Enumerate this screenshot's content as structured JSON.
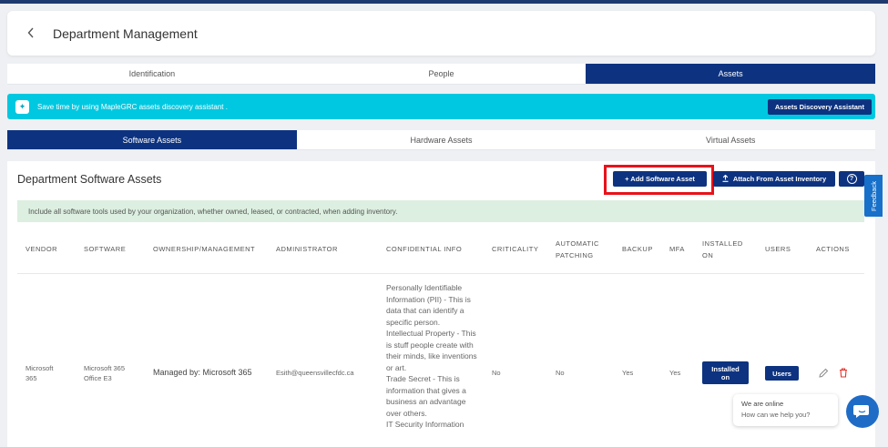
{
  "header": {
    "back_icon": "chevron-left-icon",
    "title": "Department Management"
  },
  "tabs": [
    {
      "label": "Identification",
      "active": false
    },
    {
      "label": "People",
      "active": false
    },
    {
      "label": "Assets",
      "active": true
    }
  ],
  "banner": {
    "icon": "sparkle-icon",
    "text": "Save time by using MapleGRC assets discovery assistant .",
    "button_label": "Assets Discovery Assistant"
  },
  "asset_tabs": [
    {
      "label": "Software Assets",
      "active": true
    },
    {
      "label": "Hardware Assets",
      "active": false
    },
    {
      "label": "Virtual Assets",
      "active": false
    }
  ],
  "section": {
    "title": "Department Software Assets",
    "add_label": "+  Add Software Asset",
    "attach_label": "Attach From Asset Inventory",
    "attach_icon": "upload-icon",
    "help_icon": "question-icon",
    "help_glyph": "?",
    "info_text": "Include all software tools used by your organization, whether owned, leased, or contracted, when adding inventory."
  },
  "table": {
    "columns": {
      "vendor": "VENDOR",
      "software": "SOFTWARE",
      "ownership": "OWNERSHIP/MANAGEMENT",
      "administrator": "ADMINISTRATOR",
      "confidential": "CONFIDENTIAL INFO",
      "criticality": "CRITICALITY",
      "patching": "AUTOMATIC\nPATCHING",
      "backup": "BACKUP",
      "mfa": "MFA",
      "installed": "INSTALLED\nON",
      "users": "USERS",
      "actions": "ACTIONS"
    },
    "rows": [
      {
        "vendor": "Microsoft\n365",
        "software": "Microsoft 365\nOffice E3",
        "ownership": "Managed by: Microsoft 365",
        "administrator": "Esith@queensvillecfdc.ca",
        "confidential": "Personally Identifiable Information (PII) - This is data that can identify a specific person.\nIntellectual Property - This is stuff people create with their minds, like inventions or art.\nTrade Secret - This is information that gives a business an advantage over others.\nIT Security Information",
        "criticality": "No",
        "patching": "No",
        "backup": "Yes",
        "mfa": "Yes",
        "installed_label": "Installed\non",
        "users_label": "Users",
        "edit_icon": "pencil-icon",
        "delete_icon": "trash-icon"
      }
    ]
  },
  "feedback_label": "Feedback",
  "chat": {
    "line1": "We are online",
    "line2": "How can we help you?",
    "icon": "chat-icon"
  },
  "colors": {
    "primary": "#0d3380",
    "banner": "#00c8e0",
    "info_bg": "#dcefe0",
    "highlight": "#e8121a",
    "delete": "#e0342c"
  }
}
